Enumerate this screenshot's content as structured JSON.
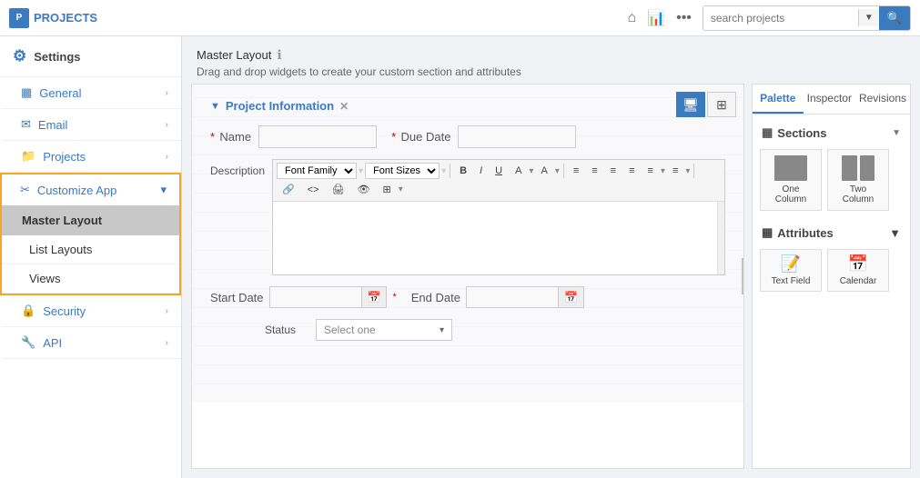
{
  "topnav": {
    "logo": "PROJECTS",
    "search_placeholder": "search projects",
    "search_dropdown_icon": "▼",
    "search_btn_icon": "🔍",
    "home_icon": "⌂",
    "chart_icon": "📊",
    "more_icon": "•••"
  },
  "sidebar": {
    "header": "Settings",
    "items": [
      {
        "id": "general",
        "label": "General",
        "icon": "▦"
      },
      {
        "id": "email",
        "label": "Email",
        "icon": "✉"
      },
      {
        "id": "projects",
        "label": "Projects",
        "icon": "📁"
      },
      {
        "id": "customize",
        "label": "Customize App",
        "icon": "✂"
      },
      {
        "id": "master-layout",
        "label": "Master Layout"
      },
      {
        "id": "list-layouts",
        "label": "List Layouts"
      },
      {
        "id": "views",
        "label": "Views"
      },
      {
        "id": "security",
        "label": "Security",
        "icon": "🔒"
      },
      {
        "id": "api",
        "label": "API",
        "icon": "🔧"
      }
    ]
  },
  "page": {
    "title": "Master Layout",
    "info_icon": "ℹ",
    "subtitle": "Drag and drop widgets to create your custom section and attributes"
  },
  "canvas_toolbar": {
    "btn1_icon": "🖥",
    "btn2_icon": "⊞"
  },
  "section": {
    "collapse_icon": "▼",
    "title": "Project Information",
    "remove_icon": "✕",
    "fields": {
      "name_label": "Name",
      "name_required": "*",
      "due_date_label": "Due Date",
      "due_date_required": "*",
      "description_label": "Description"
    },
    "editor": {
      "font_family": "Font Family",
      "font_sizes": "Font Sizes",
      "bold": "B",
      "italic": "I",
      "underline": "U",
      "text_color": "A",
      "bg_color": "A",
      "align_left": "≡",
      "align_center": "≡",
      "align_right": "≡",
      "justify": "≡",
      "ul": "≡",
      "ol": "≡",
      "link": "🔗",
      "code": "<>",
      "print": "🖨",
      "preview": "👁",
      "table": "⊞"
    },
    "start_date_label": "Start Date",
    "start_date_required": "*",
    "end_date_label": "End Date",
    "status_label": "Status",
    "status_placeholder": "Select one"
  },
  "right_panel": {
    "tabs": [
      "Palette",
      "Inspector",
      "Revisions"
    ],
    "active_tab": "Palette",
    "sections_label": "Sections",
    "sections_collapse": "▼",
    "section_icon": "▦",
    "sections": [
      {
        "label": "One Column",
        "cols": 1
      },
      {
        "label": "Two Column",
        "cols": 2
      }
    ],
    "attributes_label": "Attributes",
    "attributes_collapse": "▼",
    "attributes": [
      {
        "label": "Text Field",
        "icon": "📝"
      },
      {
        "label": "Calendar",
        "icon": "📅"
      }
    ]
  }
}
